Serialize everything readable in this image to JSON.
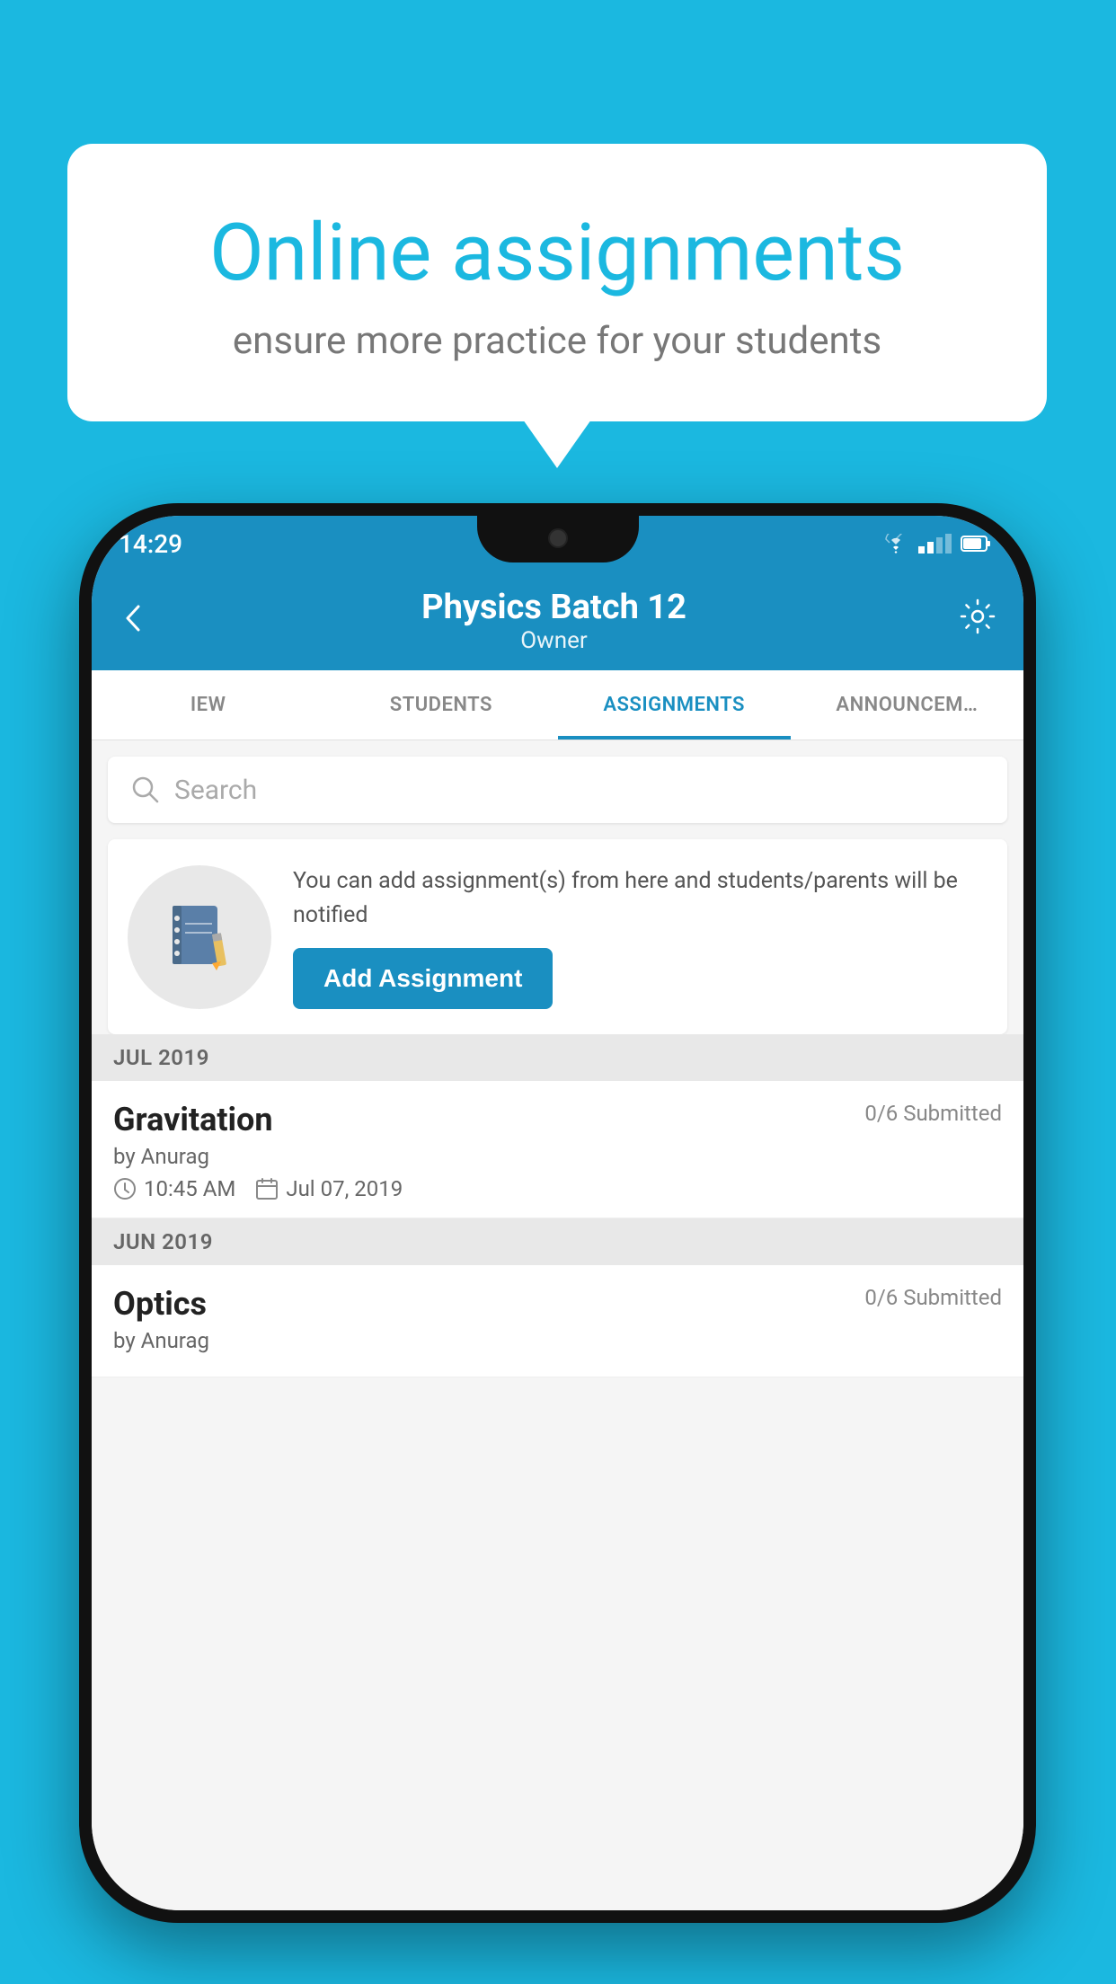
{
  "background": {
    "color": "#1BB8E0"
  },
  "speech_bubble": {
    "title": "Online assignments",
    "subtitle": "ensure more practice for your students"
  },
  "status_bar": {
    "time": "14:29"
  },
  "app_header": {
    "title": "Physics Batch 12",
    "subtitle": "Owner",
    "back_label": "←",
    "settings_label": "⚙"
  },
  "tabs": [
    {
      "label": "IEW",
      "active": false
    },
    {
      "label": "STUDENTS",
      "active": false
    },
    {
      "label": "ASSIGNMENTS",
      "active": true
    },
    {
      "label": "ANNOUNCEM…",
      "active": false
    }
  ],
  "search": {
    "placeholder": "Search"
  },
  "add_assignment_card": {
    "description": "You can add assignment(s) from here and students/parents will be notified",
    "button_label": "Add Assignment"
  },
  "sections": [
    {
      "month": "JUL 2019",
      "assignments": [
        {
          "name": "Gravitation",
          "submitted": "0/6 Submitted",
          "author": "by Anurag",
          "time": "10:45 AM",
          "date": "Jul 07, 2019"
        }
      ]
    },
    {
      "month": "JUN 2019",
      "assignments": [
        {
          "name": "Optics",
          "submitted": "0/6 Submitted",
          "author": "by Anurag",
          "time": "",
          "date": ""
        }
      ]
    }
  ]
}
